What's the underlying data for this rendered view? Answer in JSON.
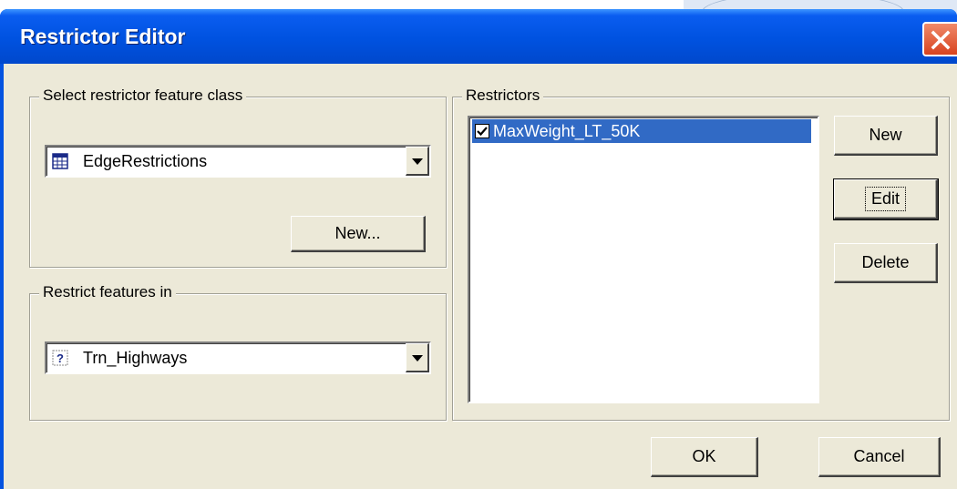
{
  "dialog": {
    "title": "Restrictor Editor"
  },
  "feature_class_group": {
    "label": "Select restrictor feature class",
    "combo_value": "EdgeRestrictions",
    "combo_icon": "table-icon",
    "new_button": "New..."
  },
  "restrict_group": {
    "label": "Restrict features in",
    "combo_value": "Trn_Highways",
    "combo_icon": "unknown-layer-icon"
  },
  "restrictors_group": {
    "label": "Restrictors",
    "items": [
      {
        "label": "MaxWeight_LT_50K",
        "checked": true,
        "selected": true
      }
    ],
    "new_button": "New",
    "edit_button": "Edit",
    "delete_button": "Delete"
  },
  "footer": {
    "ok_button": "OK",
    "cancel_button": "Cancel"
  },
  "colors": {
    "titlebar": "#0052e0",
    "selection": "#316ac5",
    "face": "#ece9d8"
  }
}
